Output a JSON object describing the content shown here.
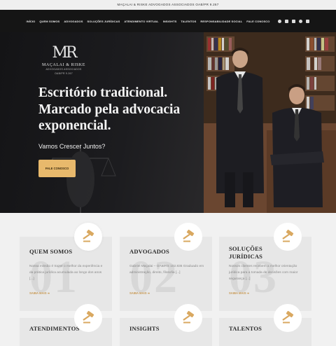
{
  "topbar": {
    "text": "MAÇALAI & RISKE ADVOGADOS ASSOCIADOS OAB/PR 9.267"
  },
  "nav": {
    "items": [
      "INÍCIO",
      "QUEM SOMOS",
      "ADVOGADOS",
      "SOLUÇÕES JURÍDICAS",
      "ATENDIMENTO VIRTUAL",
      "INSIGHTS",
      "TALENTOS",
      "RESPONSABILIDADE SOCIAL",
      "FALE CONOSCO"
    ],
    "social_icons": [
      "facebook-icon",
      "instagram-icon",
      "linkedin-icon",
      "whatsapp-icon",
      "email-icon"
    ]
  },
  "hero": {
    "logo_mark": "MR",
    "logo_name": "MAÇALAI & RISKE",
    "logo_sub_1": "ADVOGADOS ASSOCIADOS",
    "logo_sub_2": "OAB/PR 9.267",
    "headline_1": "Escritório tradicional.",
    "headline_2": "Marcado pela advocacia",
    "headline_3": "exponencial.",
    "tagline": "Vamos Crescer Juntos?",
    "cta": "FALE CONOSCO"
  },
  "cards": [
    {
      "num": "01",
      "title": "QUEM SOMOS",
      "desc": "Nossa missão é trazer o melhor da experiência e da prática jurídica acumulada ao longo dos anos [...]",
      "more": "SAIBA MAIS",
      "icon": "gavel-icon"
    },
    {
      "num": "02",
      "title": "ADVOGADOS",
      "desc": "Gabriel Maçalai – OAB/RS 102.836 Graduado em administração, direito, filosofia [...]",
      "more": "SAIBA MAIS",
      "icon": "gavel-icon"
    },
    {
      "num": "03",
      "title": "SOLUÇÕES\nJURÍDICAS",
      "desc": "Nossos clientes recebem a melhor orientação jurídica para a tomada de decisões com maior segurança [...]",
      "more": "SAIBA MAIS",
      "icon": "gavel-icon"
    },
    {
      "title": "ATENDIMENTOS",
      "icon": "gavel-icon"
    },
    {
      "title": "INSIGHTS",
      "icon": "gavel-icon"
    },
    {
      "title": "TALENTOS",
      "icon": "gavel-icon"
    }
  ],
  "colors": {
    "accent": "#e8b96c",
    "dark": "#151515",
    "card_bg": "#e7e7e7"
  }
}
